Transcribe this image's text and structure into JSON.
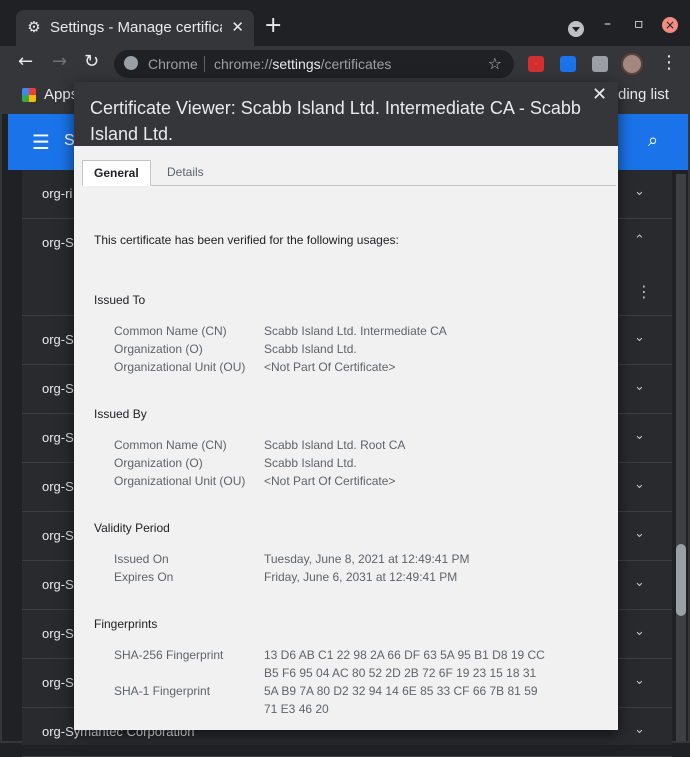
{
  "browser": {
    "tab_title": "Settings - Manage certifica",
    "omnibox_label": "Chrome",
    "url_prefix": "chrome://",
    "url_host": "settings",
    "url_path": "/certificates",
    "bookmarks_apps": "Apps",
    "reading_list": "ding list"
  },
  "settings": {
    "toolbar_title": "S",
    "rows": [
      "org-ri",
      "org-Se",
      "org-Se",
      "org-Se",
      "org-Se",
      "org-Se",
      "org-Si",
      "org-Sy",
      "org-Sy",
      "org-Sy",
      "org-Symantec Corporation"
    ]
  },
  "dialog": {
    "title": "Certificate Viewer: Scabb Island Ltd. Intermediate CA - Scabb Island Ltd.",
    "tab_general": "General",
    "tab_details": "Details",
    "verified_text": "This certificate has been verified for the following usages:",
    "issued_to": {
      "heading": "Issued To",
      "cn_label": "Common Name (CN)",
      "cn_value": "Scabb Island Ltd. Intermediate CA",
      "o_label": "Organization (O)",
      "o_value": "Scabb Island Ltd.",
      "ou_label": "Organizational Unit (OU)",
      "ou_value": "<Not Part Of Certificate>"
    },
    "issued_by": {
      "heading": "Issued By",
      "cn_label": "Common Name (CN)",
      "cn_value": "Scabb Island Ltd. Root CA",
      "o_label": "Organization (O)",
      "o_value": "Scabb Island Ltd.",
      "ou_label": "Organizational Unit (OU)",
      "ou_value": "<Not Part Of Certificate>"
    },
    "validity": {
      "heading": "Validity Period",
      "issued_label": "Issued On",
      "issued_value": "Tuesday, June 8, 2021 at 12:49:41 PM",
      "expires_label": "Expires On",
      "expires_value": "Friday, June 6, 2031 at 12:49:41 PM"
    },
    "fingerprints": {
      "heading": "Fingerprints",
      "sha256_label": "SHA-256 Fingerprint",
      "sha256_line1": "13 D6 AB C1 22 98 2A 66 DF 63 5A 95 B1 D8 19 CC",
      "sha256_line2": "B5 F6 95 04 AC 80 52 2D 2B 72 6F 19 23 15 18 31",
      "sha1_label": "SHA-1 Fingerprint",
      "sha1_line1": "5A B9 7A 80 D2 32 94 14 6E 85 33 CF 66 7B 81 59",
      "sha1_line2": "71 E3 46 20"
    }
  }
}
